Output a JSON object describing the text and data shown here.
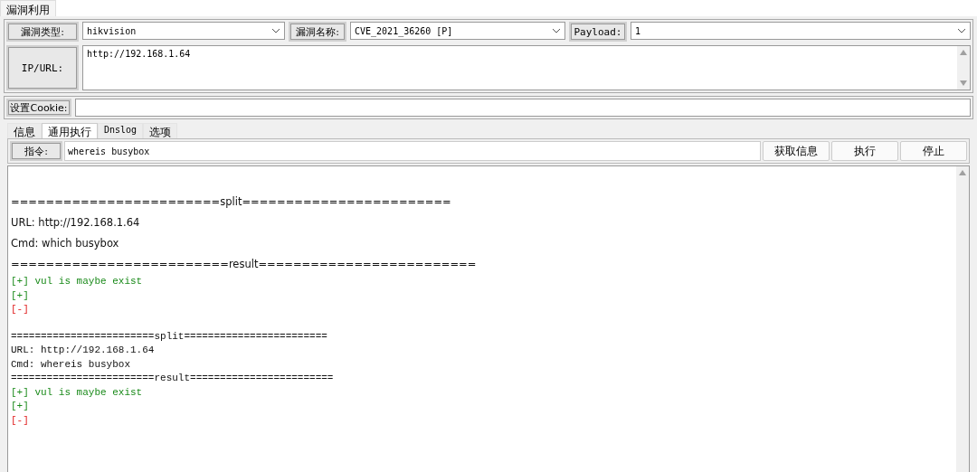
{
  "main_tabs": [
    {
      "label": "漏洞利用",
      "selected": true
    }
  ],
  "form": {
    "vuln_type": {
      "label": "漏洞类型:",
      "value": "hikvision"
    },
    "vuln_name": {
      "label": "漏洞名称:",
      "value": "CVE_2021_36260 [P]"
    },
    "payload": {
      "label": "Payload:",
      "value": "1"
    },
    "target": {
      "label": "IP/URL:",
      "value": "http://192.168.1.64"
    },
    "cookie": {
      "label": "设置Cookie:"
    }
  },
  "sub_tabs": [
    {
      "label": "信息",
      "selected": false
    },
    {
      "label": "通用执行",
      "selected": true
    },
    {
      "label": "Dnslog",
      "selected": false
    },
    {
      "label": "选项",
      "selected": false
    }
  ],
  "command": {
    "label": "指令:",
    "value": "whereis busybox",
    "buttons": [
      "获取信息",
      "执行",
      "停止"
    ]
  },
  "output": [
    {
      "lines": [
        {
          "kind": "sans",
          "text": "========================split========================"
        },
        {
          "kind": "sans",
          "text": "URL: http://192.168.1.64"
        },
        {
          "kind": "sans",
          "text": "Cmd: which busybox"
        },
        {
          "kind": "sans",
          "text": "=========================result========================="
        },
        {
          "kind": "ok",
          "text": "[+] vul is maybe exist"
        },
        {
          "kind": "ok",
          "text": "[+]"
        },
        {
          "kind": "fail",
          "text": "[-]"
        }
      ]
    },
    {
      "lines": [
        {
          "kind": "plain",
          "text": "========================split========================"
        },
        {
          "kind": "plain",
          "text": "URL: http://192.168.1.64"
        },
        {
          "kind": "plain",
          "text": "Cmd: whereis busybox"
        },
        {
          "kind": "plain",
          "text": "========================result========================"
        },
        {
          "kind": "ok",
          "text": "[+] vul is maybe exist"
        },
        {
          "kind": "ok",
          "text": "[+]"
        },
        {
          "kind": "fail",
          "text": "[-]"
        }
      ]
    }
  ]
}
